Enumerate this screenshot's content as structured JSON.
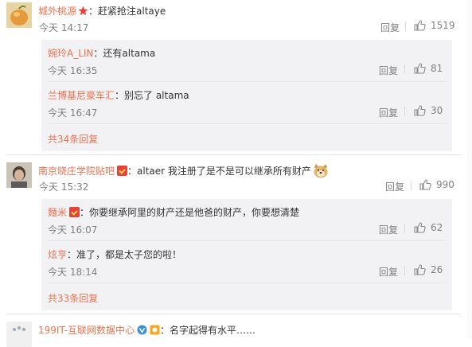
{
  "colors": {
    "username": "#eb7350",
    "text": "#333333",
    "meta": "#808080",
    "subbg": "#f2f2f5"
  },
  "comments": [
    {
      "user": "城外桃源",
      "text": "：赶紧抢注altaye",
      "time": "今天 14:17",
      "reply_label": "回复",
      "likes": "1519",
      "replies": [
        {
          "user": "婉玲A_LIN",
          "text": "：还有altama",
          "time": "今天 16:35",
          "reply_label": "回复",
          "likes": "81"
        },
        {
          "user": "兰博基尼豪车汇",
          "text": "：别忘了  altama",
          "time": "今天 16:47",
          "reply_label": "回复",
          "likes": "30"
        }
      ],
      "more": "共34条回复"
    },
    {
      "user": "南京晓庄学院贴吧",
      "text": "：altaer 我注册了是不是可以继承所有财产",
      "time": "今天 15:32",
      "reply_label": "回复",
      "likes": "990",
      "replies": [
        {
          "user": "麵米",
          "text": "：你要继承阿里的财产还是他爸的财产，你要想清楚",
          "time": "今天 16:07",
          "reply_label": "回复",
          "likes": "62"
        },
        {
          "user": "炫亨",
          "text": "：准了，都是太子您的啦！",
          "time": "今天 18:14",
          "reply_label": "回复",
          "likes": "26"
        }
      ],
      "more": "共33条回复"
    },
    {
      "user": "199IT-互联网数据中心",
      "text": "：名字起得有水平……"
    }
  ]
}
